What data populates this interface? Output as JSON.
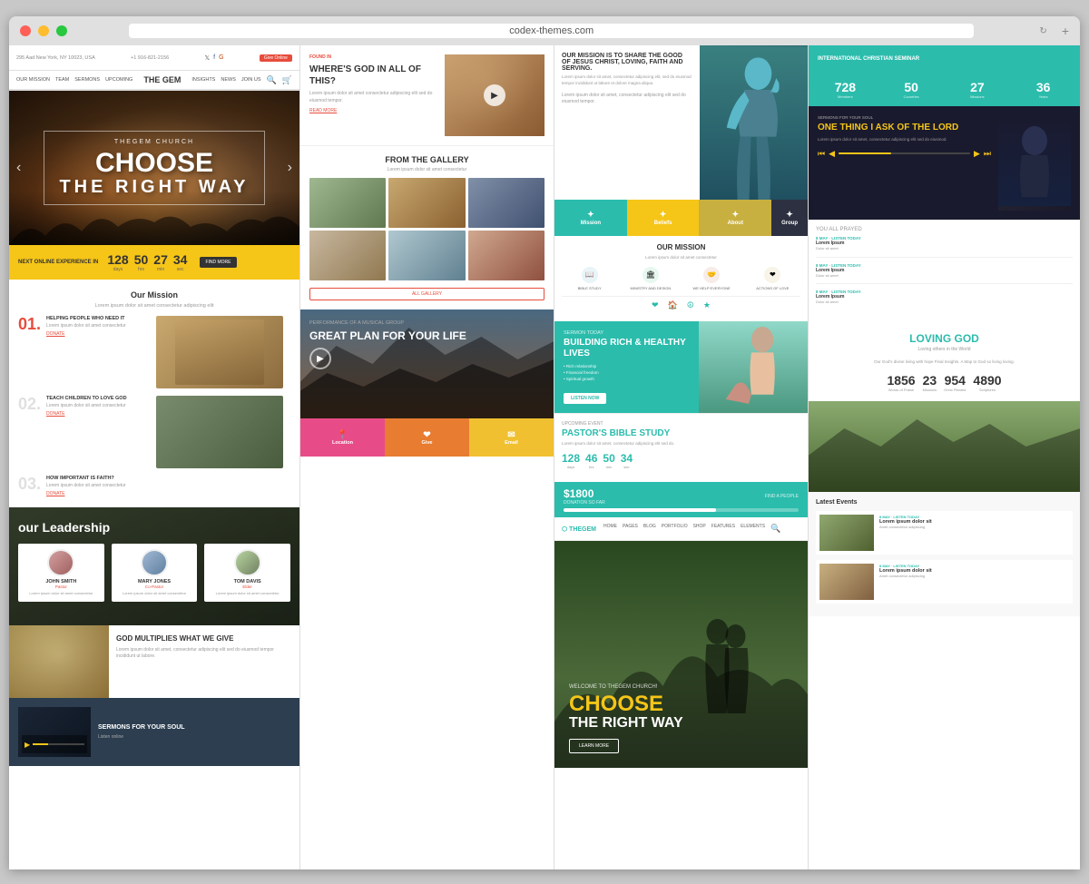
{
  "browser": {
    "url": "codex-themes.com",
    "dots": [
      "red",
      "yellow",
      "green"
    ]
  },
  "leftCol": {
    "nav": {
      "address": "295 Aad New York, NY 10023, USA",
      "phone": "+1 916-821-2156",
      "links": [
        "OUR MISSION",
        "TEAM",
        "SERMONS",
        "UPCOMING"
      ],
      "logo": "THE GEM",
      "extraLinks": [
        "INSIGHTS",
        "NEWS",
        "JOIN US"
      ],
      "ctaBtn": "Give Online"
    },
    "hero": {
      "subtitle": "THEGEM CHURCH",
      "title": "CHOOSE\nTHE RIGHT WAY"
    },
    "countdown": {
      "label": "NEXT ONLINE EXPERIENCE IN",
      "nums": [
        {
          "num": "128",
          "unit": "days"
        },
        {
          "num": "50",
          "unit": "hrs"
        },
        {
          "num": "27",
          "unit": "min"
        },
        {
          "num": "34",
          "unit": "sec"
        }
      ],
      "cta": "FIND MORE"
    },
    "mission": {
      "title": "Our Mission",
      "items": [
        {
          "num": "01",
          "title": "HELPING PEOPLE WHO NEED IT",
          "text": "Lorem ipsum dolor sit amet consectetur",
          "link": "DONATE"
        },
        {
          "num": "02",
          "title": "TEACH CHILDREN TO LOVE GOD",
          "text": "Lorem ipsum dolor sit amet consectetur",
          "link": "DONATE"
        },
        {
          "num": "03",
          "title": "HOW IMPORTANT IS FAITH?",
          "text": "Lorem ipsum dolor sit amet consectetur",
          "link": "DONATE"
        }
      ]
    },
    "leadership": {
      "title": "our Leadership",
      "members": [
        {
          "name": "JOHN SMITH",
          "role": "Pastor"
        },
        {
          "name": "MARY JONES",
          "role": "Co-Pastor"
        },
        {
          "name": "TOM DAVIS",
          "role": "Elder"
        }
      ]
    },
    "godMultiplies": {
      "title": "GOD MULTIPLIES WHAT WE GIVE",
      "text": "Lorem ipsum dolor sit amet, consectetur adipiscing elit sed do eiusmod tempor incididunt ut labore."
    },
    "sermonsFooter": {
      "title": "SERMONS FOR YOUR SOUL",
      "sub": "Listen online"
    }
  },
  "midLeftCol": {
    "wheresGod": {
      "tag": "FOUND IN",
      "title": "WHERE'S GOD IN ALL OF THIS?",
      "text": "Lorem ipsum dolor sit amet consectetur adipiscing elit sed do eiusmod tempor.",
      "link": "READ MORE"
    },
    "gallery": {
      "title": "FROM THE GALLERY",
      "sub": "Lorem ipsum dolor sit amet consectetur",
      "btnLabel": "ALL GALLERY"
    },
    "concert": {
      "label": "PERFORMANCE OF A MUSICAL GROUP",
      "title": "GREAT PLAN FOR YOUR LIFE"
    },
    "footerTabs": [
      {
        "label": "Location",
        "icon": "📍"
      },
      {
        "label": "Give",
        "icon": "❤"
      },
      {
        "label": "Email",
        "icon": "✉"
      }
    ]
  },
  "midRightCol": {
    "missionTop": {
      "title": "OUR MISSION IS TO SHARE THE GOOD OF JESUS CHRIST, LOVING, FAITH AND SERVING.",
      "text": "Lorem ipsum dolor sit amet, consectetur adipiscing elit, sed do eiusmod tempor incididunt ut labore et dolore magna aliqua."
    },
    "colorBlocks": [
      "Mission",
      "Beliefs",
      "About",
      "Group"
    ],
    "missionContent": {
      "title": "OUR MISSION",
      "text": "Lorem ipsum dolor sit amet consectetur",
      "icons": [
        "BIBLE STUDY",
        "MINISTRY AND DESIGN",
        "WE HELP EVERYONE",
        "ACTIONS OF LOVE"
      ]
    },
    "sermonToday": {
      "label": "SERMON TODAY",
      "title": "BUILDING RICH & HEALTHY LIVES",
      "items": [
        "Rich relationship",
        "Financial freedom",
        "Spiritual growth"
      ],
      "btnLabel": "LISTEN NOW"
    },
    "upcomingEvent": {
      "label": "UPCOMING EVENT",
      "title": "PASTOR'S BIBLE STUDY",
      "text": "Lorem ipsum dolor sit amet, consectetur adipiscing elit sed do.",
      "countdown": [
        {
          "num": "128",
          "unit": "days"
        },
        {
          "num": "46",
          "unit": "hrs"
        },
        {
          "num": "50",
          "unit": "min"
        },
        {
          "num": "34",
          "unit": "sec"
        }
      ]
    },
    "donation": {
      "amount": "$1800",
      "label": "DONATION SO FAR",
      "progress": 65
    },
    "hero2": {
      "welcome": "WELCOME TO THEGEM CHURCH!",
      "title": "CHOOSE",
      "subtitle": "THE RIGHT WAY",
      "btnLabel": "LEARN MORE"
    }
  },
  "rightCol": {
    "seminar": {
      "title": "INTERNATIONAL CHRISTIAN SEMINAR"
    },
    "stats": [
      {
        "num": "728",
        "label": "Members"
      },
      {
        "num": "50",
        "label": "Countries"
      },
      {
        "num": "27",
        "label": "Missions"
      },
      {
        "num": "36",
        "label": "Years"
      }
    ],
    "sermonsForSoul": {
      "tag": "SERMONS FOR YOUR SOUL",
      "title": "ONE THING I ASK OF THE LORD",
      "text": "Lorem ipsum dolor sit amet, consectetur adipiscing elit sed do eiusmod."
    },
    "schedule": [
      {
        "date": "8 MAY · LISTEN TODAY",
        "title": "Lorem Ipsum",
        "text": "Dolor sit amet"
      },
      {
        "date": "8 MAY · LISTEN TODAY",
        "title": "Lorem Ipsum",
        "text": "Dolor sit amet"
      },
      {
        "date": "8 MAY · LISTEN TODAY",
        "title": "Lorem Ipsum",
        "text": "Dolor sit amet"
      }
    ],
    "lovingGod": {
      "title": "LOVING GOD",
      "sub": "Loving others in the World",
      "text": "Our God's divine living with hope Final Insights. A Map to God so living loving.",
      "stats": [
        {
          "num": "1856",
          "label": "Words of Praise"
        },
        {
          "num": "23",
          "label": "Missions"
        },
        {
          "num": "954",
          "label": "Grew Planted"
        },
        {
          "num": "4890",
          "label": "Scriptures"
        }
      ]
    },
    "latestEvents": {
      "title": "Latest Events",
      "items": [
        {
          "date": "8 MAY · LISTEN TODAY",
          "title": "Lorem ipsum dolor sit",
          "text": "Amet consectetur adipiscing"
        },
        {
          "date": "8 MAY · LISTEN TODAY",
          "title": "Lorem ipsum dolor sit",
          "text": "Amet consectetur adipiscing"
        }
      ]
    }
  }
}
